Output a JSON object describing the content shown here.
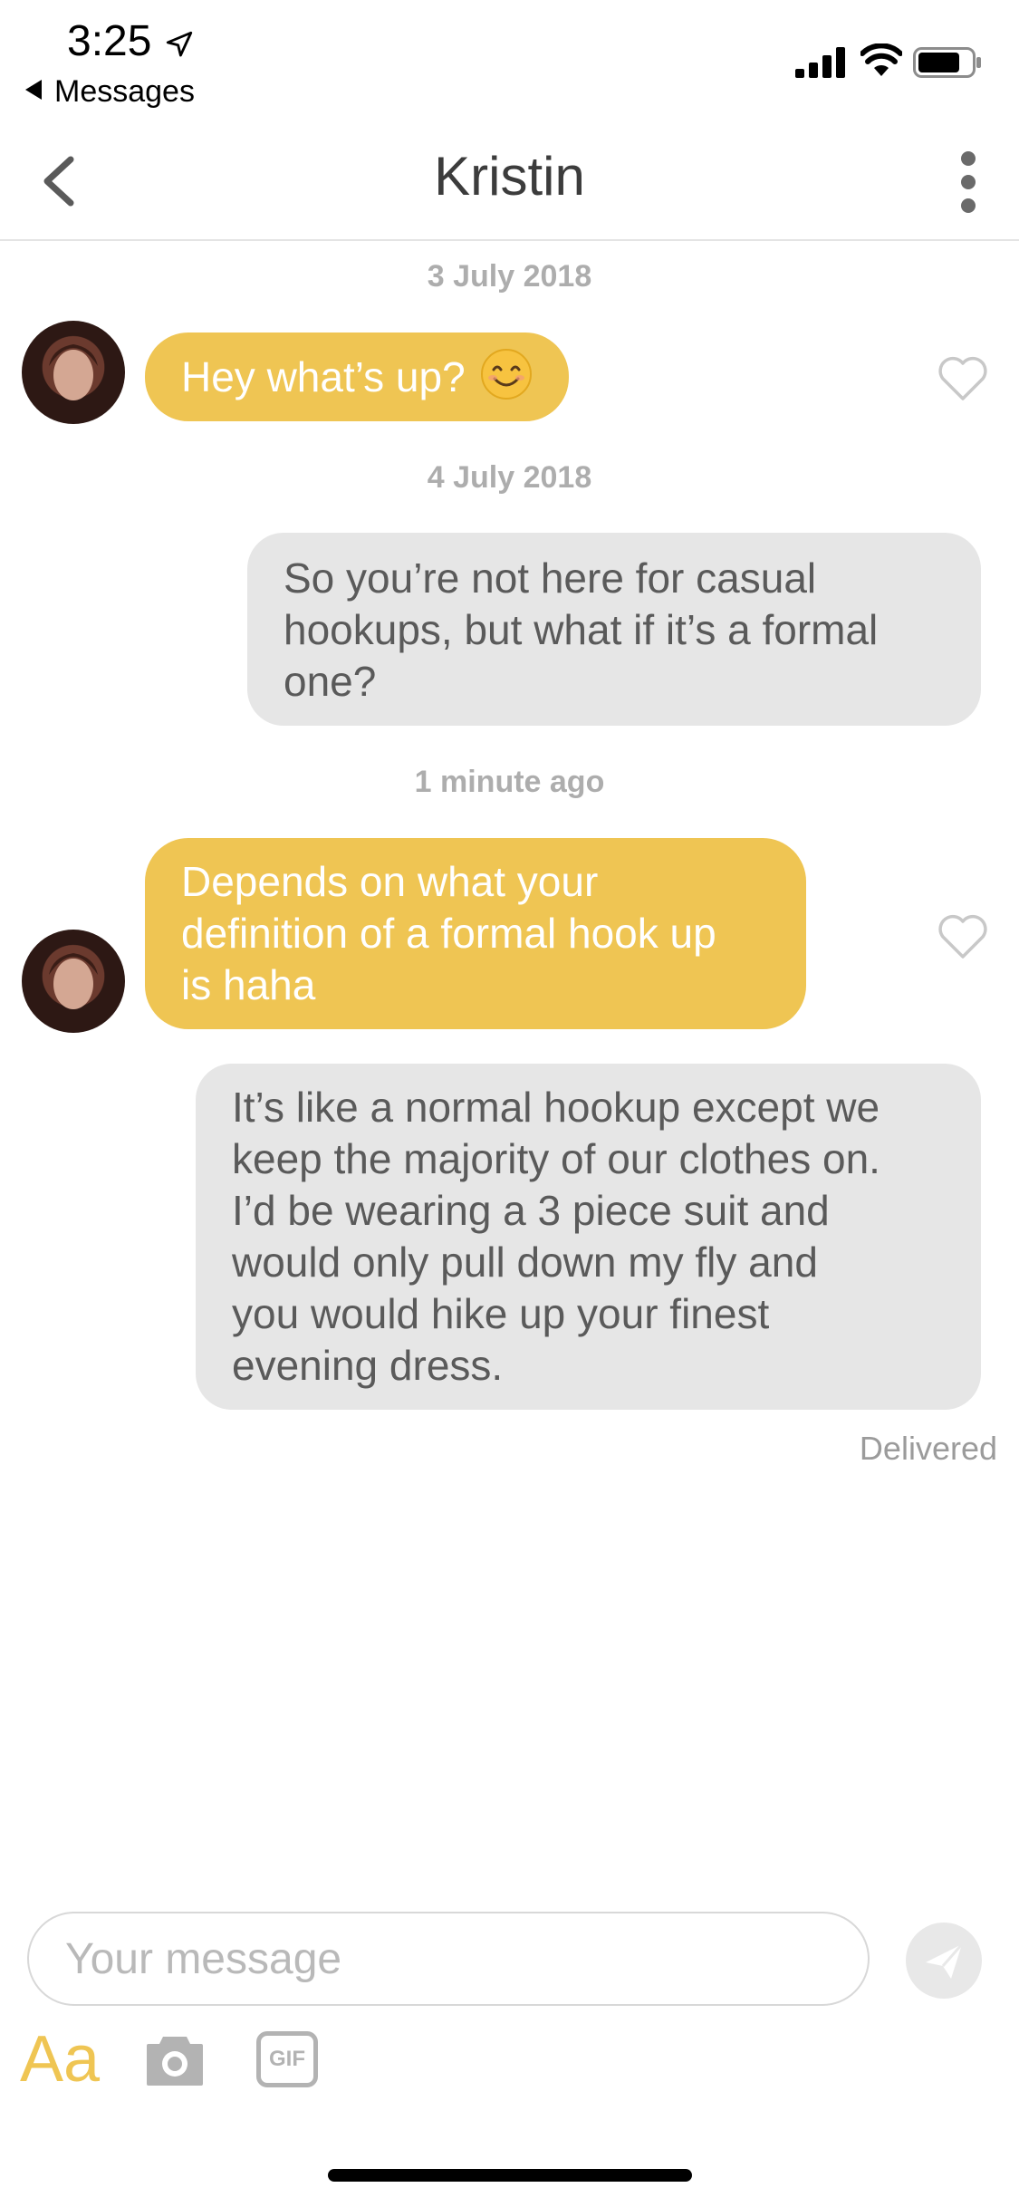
{
  "status_bar": {
    "time": "3:25",
    "back_app_label": "Messages",
    "icons": [
      "location-arrow-icon",
      "cellular-signal-icon",
      "wifi-icon",
      "battery-icon"
    ]
  },
  "header": {
    "title": "Kristin",
    "back_icon": "chevron-left-icon",
    "menu_icon": "vertical-dots-icon"
  },
  "conversation": {
    "dates": [
      "3 July 2018",
      "4 July 2018",
      "1 minute ago"
    ],
    "messages": [
      {
        "from": "them",
        "text": "Hey what’s up?",
        "emoji": "smiling-face-emoji-icon"
      },
      {
        "from": "me",
        "text": "So you’re not here for casual\nhookups, but what if it’s a formal\none?"
      },
      {
        "from": "them",
        "text": "Depends on what your\ndefinition of a formal hook up\nis haha"
      },
      {
        "from": "me",
        "text": "It’s like a normal hookup except we\nkeep the majority of our clothes on.\nI’d be wearing a 3 piece suit and\nwould only pull down my fly and\nyou would hike up your finest\nevening dress."
      }
    ],
    "delivered_label": "Delivered"
  },
  "composer": {
    "placeholder": "Your message",
    "value": "",
    "font_button_label": "Aa",
    "gif_button_label": "GIF"
  },
  "colors": {
    "incoming_bubble": "#efc553",
    "outgoing_bubble": "#e6e6e6",
    "accent": "#efc553",
    "date_text": "#adadad"
  }
}
